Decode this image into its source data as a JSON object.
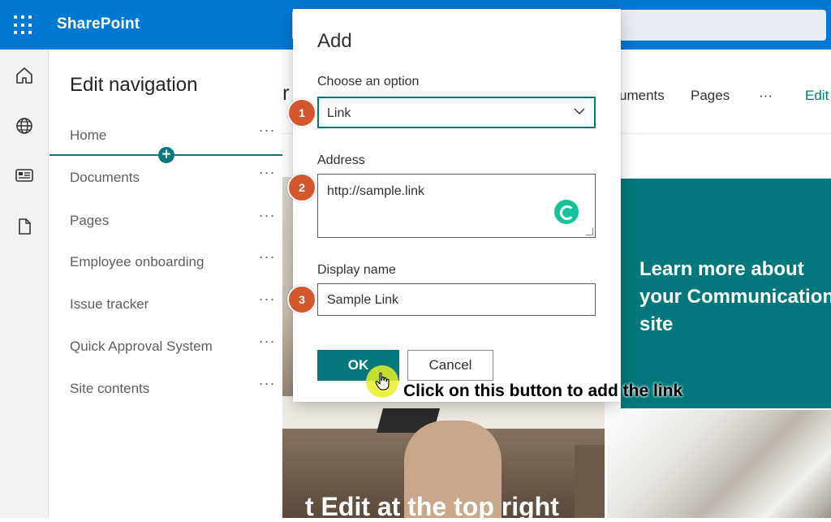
{
  "app": {
    "brand": "SharePoint",
    "accent": "#0078d4",
    "theme": "#03787c"
  },
  "rail": {
    "icons": [
      "home-icon",
      "globe-icon",
      "news-icon",
      "document-icon"
    ]
  },
  "nav_panel": {
    "title": "Edit navigation",
    "items": [
      {
        "label": "Home",
        "more": "···"
      },
      {
        "label": "Documents",
        "more": "···"
      },
      {
        "label": "Pages",
        "more": "···"
      },
      {
        "label": "Employee onboarding",
        "more": "···"
      },
      {
        "label": "Issue tracker",
        "more": "···"
      },
      {
        "label": "Quick Approval System",
        "more": "···"
      },
      {
        "label": "Site contents",
        "more": "···"
      }
    ]
  },
  "page_header": {
    "partial_title": "r",
    "nav": [
      "uments",
      "Pages",
      "···",
      "Edit"
    ]
  },
  "content": {
    "teal_tile_lines": [
      "Learn more about",
      "your Communication",
      "site"
    ],
    "hero_caption": "t Edit at the top right"
  },
  "dialog": {
    "title": "Add",
    "option_label": "Choose an option",
    "option_value": "Link",
    "address_label": "Address",
    "address_value": "http://sample.link",
    "display_label": "Display name",
    "display_value": "Sample Link",
    "ok_label": "OK",
    "cancel_label": "Cancel"
  },
  "annotations": {
    "step1": "1",
    "step2": "2",
    "step3": "3",
    "hint": "Click on this button to add the link",
    "badge_color": "#d2572c"
  }
}
